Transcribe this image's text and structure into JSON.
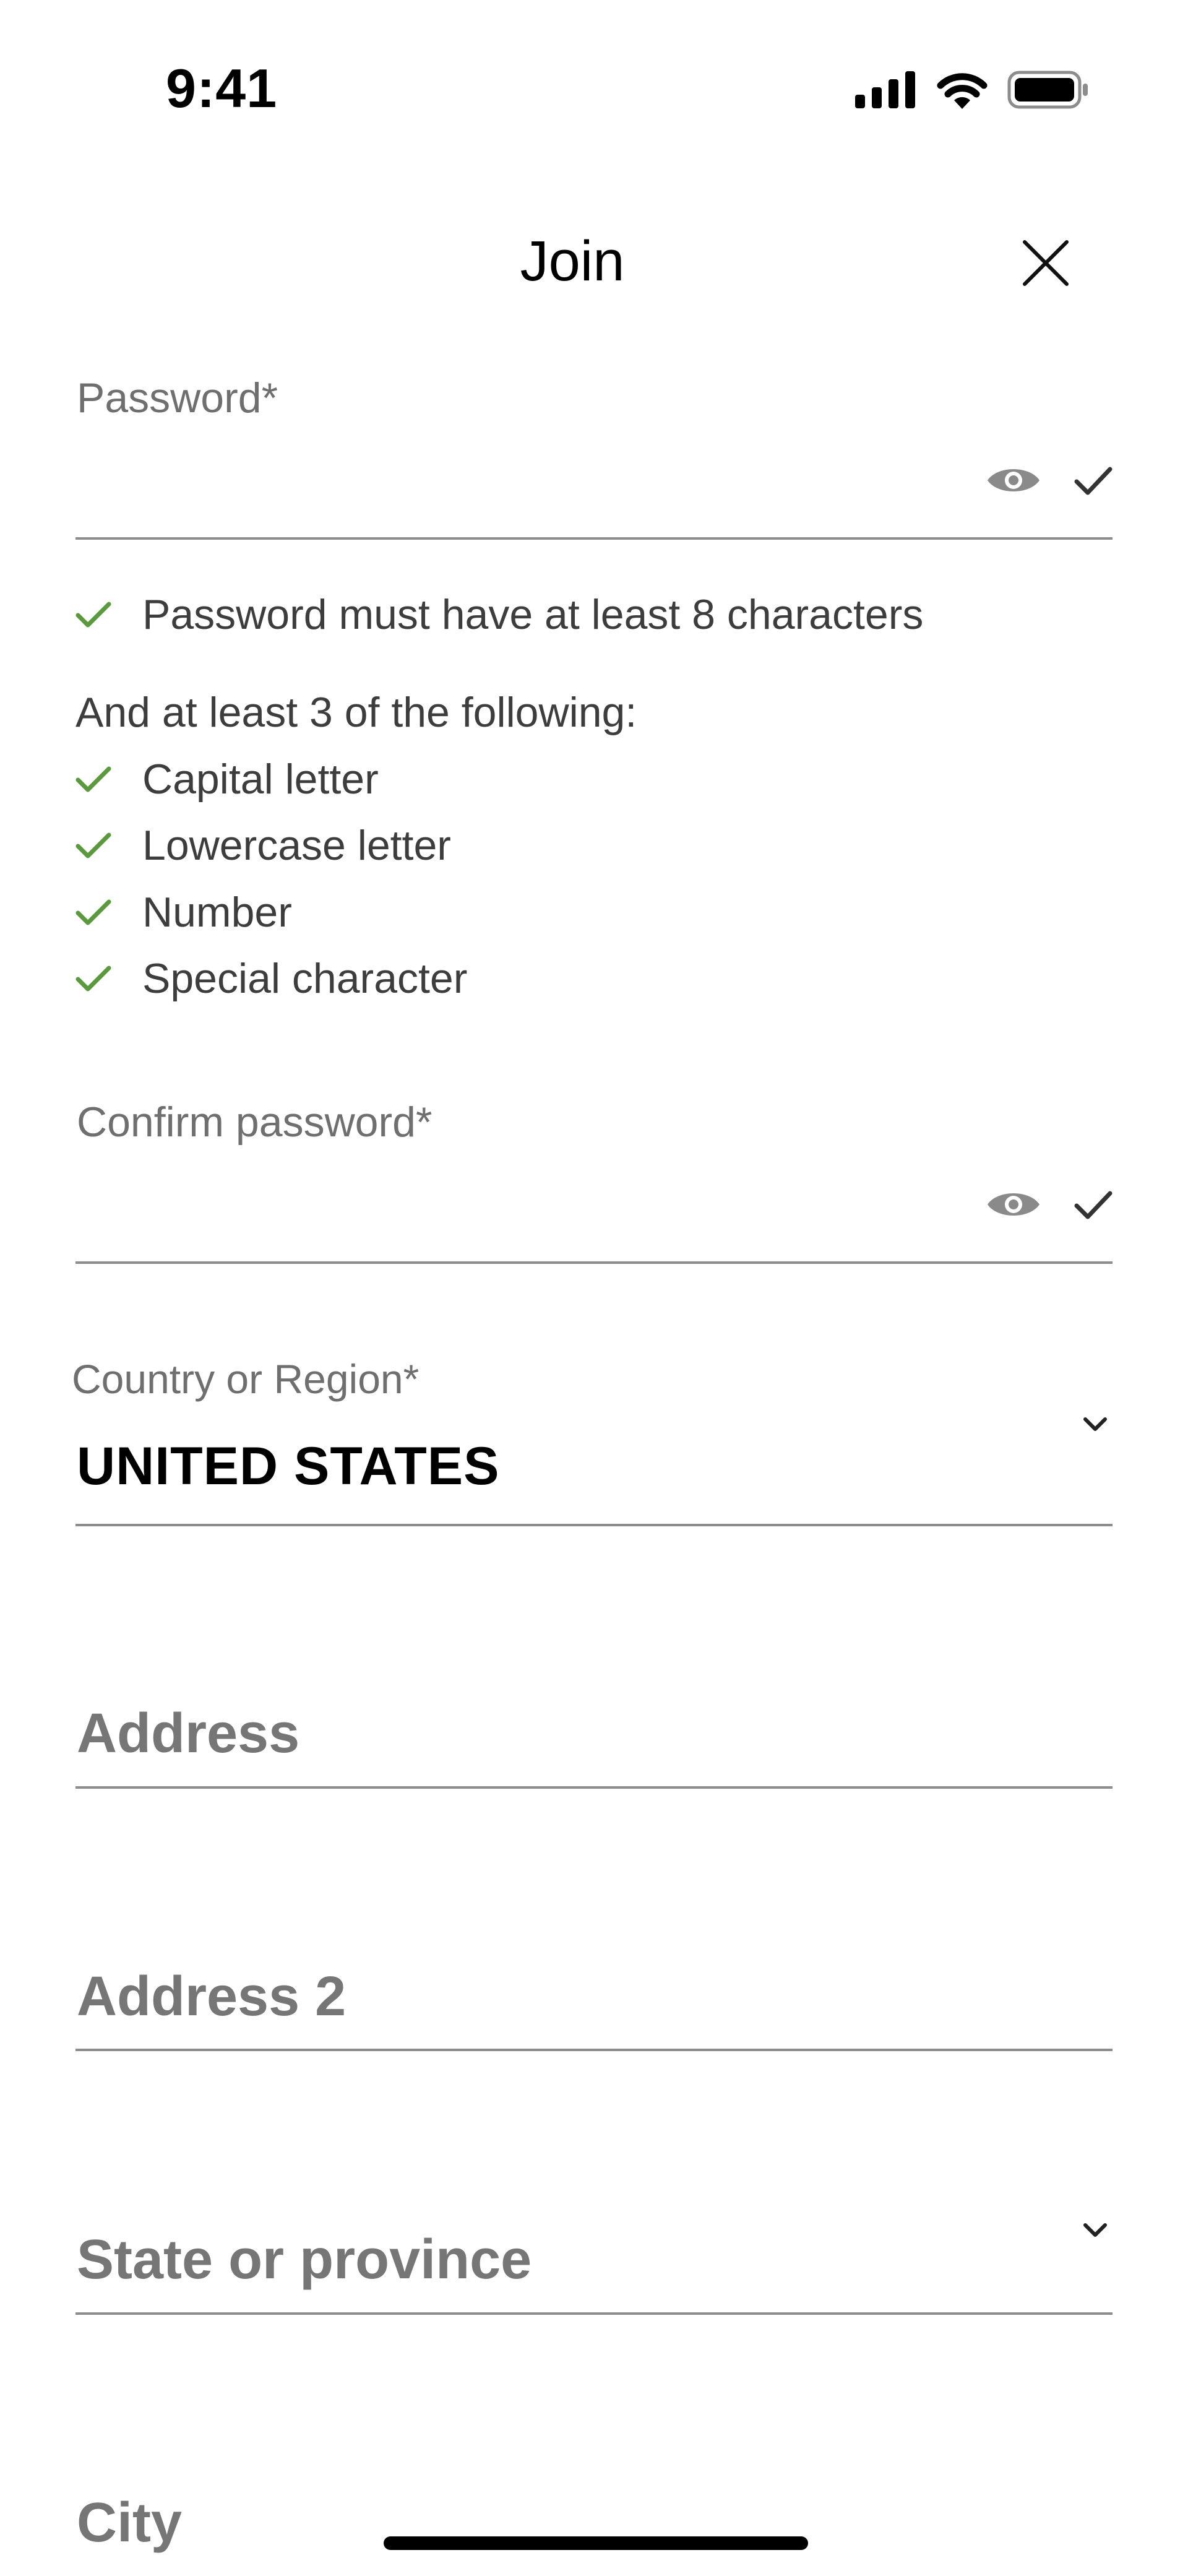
{
  "status_bar": {
    "time": "9:41"
  },
  "header": {
    "title": "Join"
  },
  "password": {
    "label": "Password*"
  },
  "requirements": {
    "min_length": "Password must have at least 8 characters",
    "intro": "And at least 3 of the following:",
    "items": [
      "Capital letter",
      "Lowercase letter",
      "Number",
      "Special character"
    ]
  },
  "confirm_password": {
    "label": "Confirm password*"
  },
  "country": {
    "label": "Country or Region*",
    "value": "UNITED STATES"
  },
  "address": {
    "placeholder": "Address"
  },
  "address2": {
    "placeholder": "Address 2"
  },
  "state": {
    "placeholder": "State or province"
  },
  "city": {
    "placeholder": "City"
  },
  "colors": {
    "check_green": "#5a9a3c",
    "label_gray": "#6f6f6f",
    "divider": "#8d8d8d"
  }
}
